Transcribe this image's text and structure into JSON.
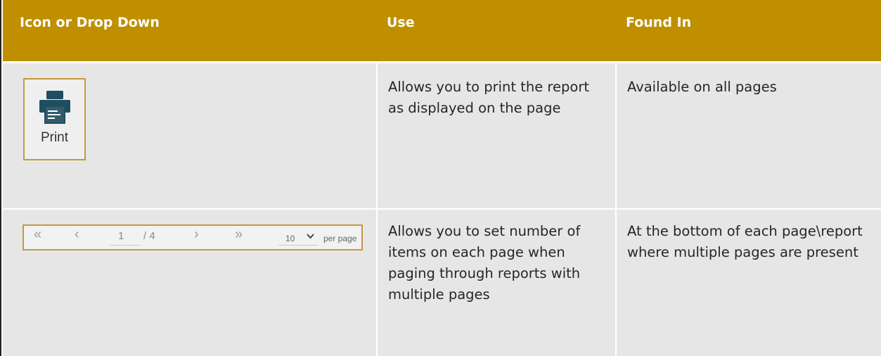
{
  "headers": {
    "icon": "Icon or Drop Down",
    "use": "Use",
    "found": "Found In"
  },
  "rows": [
    {
      "icon_name": "printer-icon",
      "icon_label": "Print",
      "use": "Allows you to print the report as displayed on the page",
      "found": "Available on all pages"
    },
    {
      "pager": {
        "first": "«",
        "prev": "‹",
        "current_page": "1",
        "total": "/ 4",
        "next": "›",
        "last": "»",
        "per_page_value": "10",
        "per_page_label": "per page"
      },
      "use": "Allows you to set number of items on each page when paging through reports with multiple pages",
      "found": "At the bottom of each page\\report where multiple pages are present"
    }
  ],
  "colors": {
    "header_bg": "#bf8f00",
    "row_bg": "#e6e6e6",
    "icon_teal": "#1f4e5f",
    "box_border": "#c39a3e"
  }
}
